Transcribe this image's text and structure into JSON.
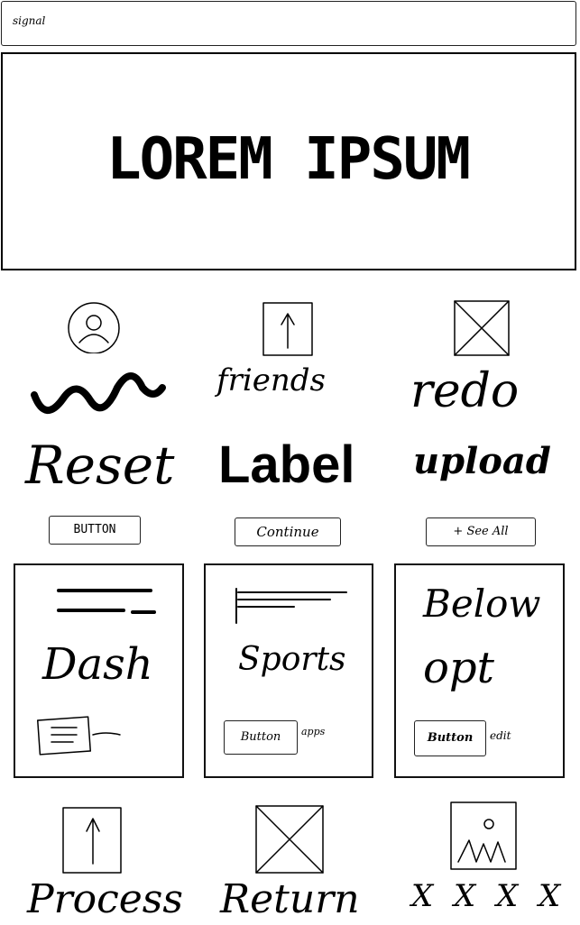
{
  "topbar": {
    "label": "signal"
  },
  "hero": {
    "title": "LOREM IPSUM"
  },
  "row1": {
    "col1": {
      "icon": "user-avatar-icon",
      "label": ""
    },
    "col2": {
      "icon": "upload-arrow-icon",
      "label": "friends"
    },
    "col3": {
      "icon": "image-placeholder-icon",
      "label": "redo"
    }
  },
  "row2": {
    "col1": "Reset",
    "col2": "Label",
    "col3": "upload"
  },
  "row3": {
    "col1": "BUTTON",
    "col2": "Continue",
    "col3": "+ See All"
  },
  "cards": [
    {
      "title": "Dash",
      "footer_icon": "document-icon"
    },
    {
      "title": "Sports",
      "button": "Button",
      "button_caption": "apps"
    },
    {
      "title_line1": "Below",
      "title_line2": "opt",
      "button": "Button",
      "button_caption": "edit"
    }
  ],
  "bottom": {
    "col1": {
      "icon": "upload-arrow-icon",
      "label": "Process"
    },
    "col2": {
      "icon": "image-placeholder-icon",
      "label": "Return"
    },
    "col3": {
      "icon": "picture-icon",
      "label": "X X X X"
    }
  }
}
